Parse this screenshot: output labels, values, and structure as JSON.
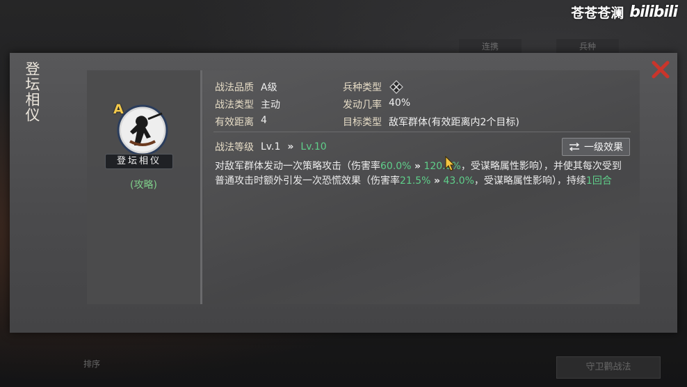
{
  "watermark": {
    "author": "苍苍苍澜",
    "brand": "bilibili"
  },
  "background": {
    "tab_1": "连携",
    "tab_2": "兵种",
    "button": "守卫鹳战法",
    "filter": "排序"
  },
  "modal": {
    "title": "登坛相仪",
    "close_icon": "close-x-icon",
    "skill_card": {
      "grade": "A",
      "name": "登坛相仪",
      "guide_link": "(攻略)"
    },
    "attributes": {
      "quality_label": "战法品质",
      "quality_value": "A级",
      "type_label": "战法类型",
      "type_value": "主动",
      "range_label": "有效距离",
      "range_value": "4",
      "unit_label": "兵种类型",
      "unit_icon": "troop-type-icon",
      "rate_label": "发动几率",
      "rate_value": "40%",
      "target_label": "目标类型",
      "target_value": "敌军群体(有效距离内2个目标)"
    },
    "level": {
      "label": "战法等级",
      "current": "Lv.1",
      "arrow": "»",
      "max": "Lv.10"
    },
    "effect_button": {
      "label": "一级效果",
      "icon": "swap-arrows-icon"
    },
    "description": {
      "p1": "对敌军群体发动一次策略攻击（伤害率",
      "v1a": "60.0%",
      "a1": "»",
      "v1b": "120.0%",
      "p2": "，受谋略属性影响），并使其每次受到普通攻击时额外引发一次恐慌效果（伤害率",
      "v2a": "21.5%",
      "a2": "»",
      "v2b": "43.0%",
      "p3": "，受谋略属性影响），持续",
      "v3": "1回合"
    },
    "colors": {
      "highlight": "#5fcf8a",
      "grade": "#f2c94c",
      "close": "#c9352b"
    }
  }
}
